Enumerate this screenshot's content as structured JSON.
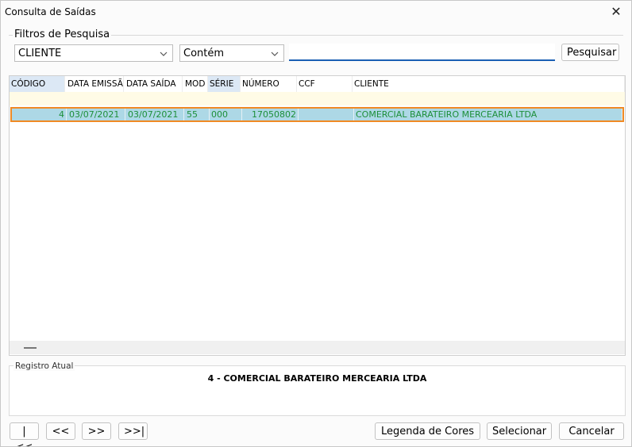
{
  "window": {
    "title": "Consulta de Saídas"
  },
  "filters": {
    "group_label": "Filtros de Pesquisa",
    "field_select": "CLIENTE",
    "operator_select": "Contém",
    "search_value": "",
    "search_button": "Pesquisar"
  },
  "grid": {
    "columns": [
      "CÓDIGO",
      "DATA EMISSÃO",
      "DATA SAÍDA",
      "MOD",
      "SÉRIE",
      "NÚMERO",
      "CCF",
      "CLIENTE"
    ],
    "rows": [
      {
        "codigo": "4",
        "data_emissao": "03/07/2021",
        "data_saida": "03/07/2021",
        "mod": "55",
        "serie": "000",
        "numero": "17050802",
        "ccf": "",
        "cliente": "COMERCIAL BARATEIRO MERCEARIA LTDA"
      }
    ]
  },
  "registro": {
    "label": "Registro Atual",
    "text": "4 - COMERCIAL BARATEIRO MERCEARIA LTDA"
  },
  "footer": {
    "first": "|<<",
    "prev": "<<",
    "next": ">>",
    "last": ">>|",
    "legend": "Legenda de Cores",
    "select": "Selecionar",
    "cancel": "Cancelar"
  },
  "colors": {
    "selected_row_bg": "#add8e6",
    "selected_row_border": "#f08a24",
    "row_text": "#1d8f3a",
    "filter_row_bg": "#fffbe6",
    "search_underline": "#1a5fb4"
  }
}
